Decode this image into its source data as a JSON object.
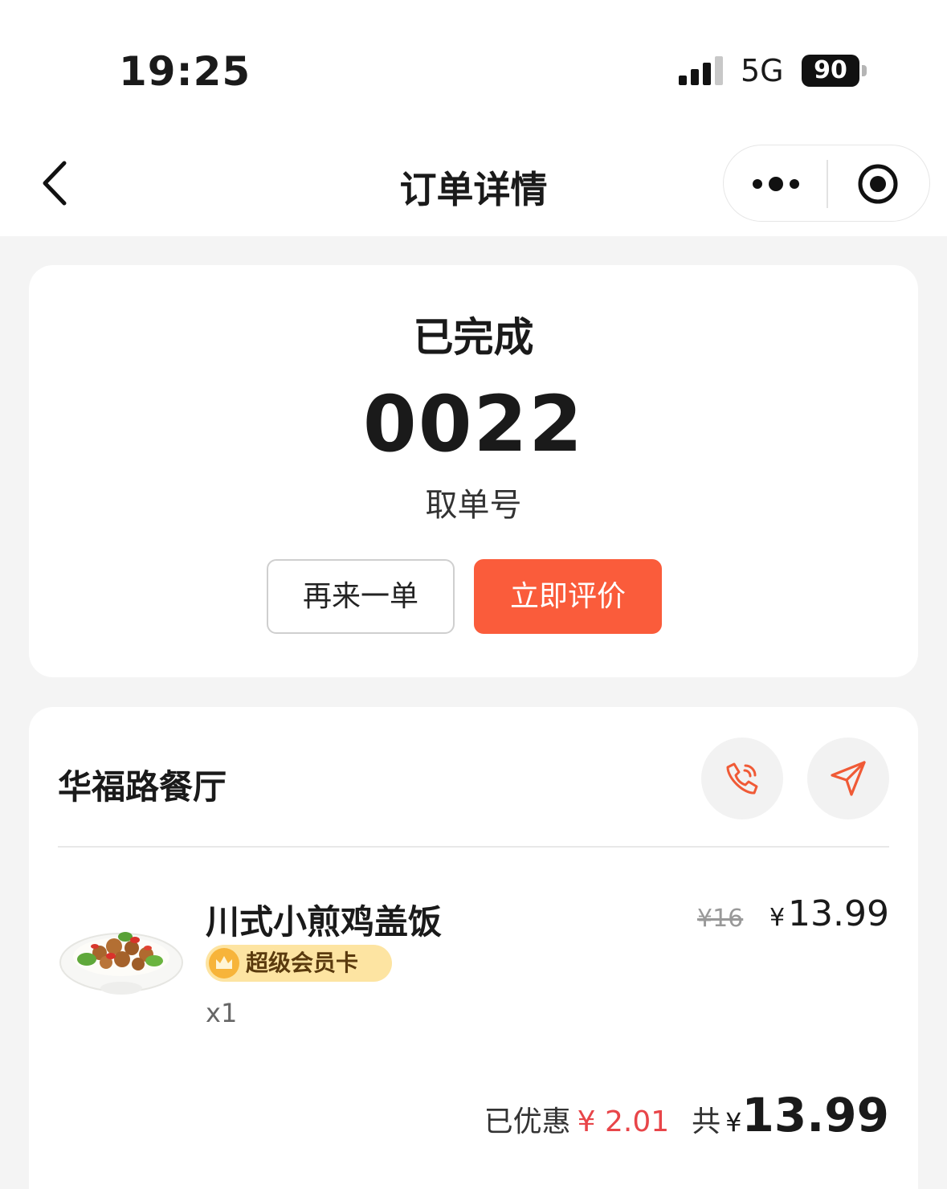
{
  "status_bar": {
    "time": "19:25",
    "network": "5G",
    "battery": "90",
    "signal_icon": "signal-bars-icon"
  },
  "nav": {
    "title": "订单详情",
    "back_icon": "chevron-left-icon",
    "more_icon": "more-dots-icon",
    "close_icon": "target-circle-icon"
  },
  "order_status": {
    "status": "已完成",
    "pickup_number": "0022",
    "pickup_label": "取单号",
    "reorder_label": "再来一单",
    "review_label": "立即评价"
  },
  "store": {
    "name": "华福路餐厅",
    "call_icon": "phone-call-icon",
    "navigate_icon": "navigation-arrow-icon"
  },
  "items": [
    {
      "name": "川式小煎鸡盖饭",
      "badge": "超级会员卡",
      "quantity": "x1",
      "original_price": "¥16",
      "currency": "¥",
      "price": "13.99"
    }
  ],
  "summary": {
    "discount_label": "已优惠",
    "discount_amount": "¥ 2.01",
    "total_label": "共",
    "currency": "¥",
    "total": "13.99"
  },
  "colors": {
    "accent": "#fa5c3b",
    "discount": "#e84549",
    "vip_badge": "#fde4a2",
    "page_background": "#f4f4f4"
  }
}
